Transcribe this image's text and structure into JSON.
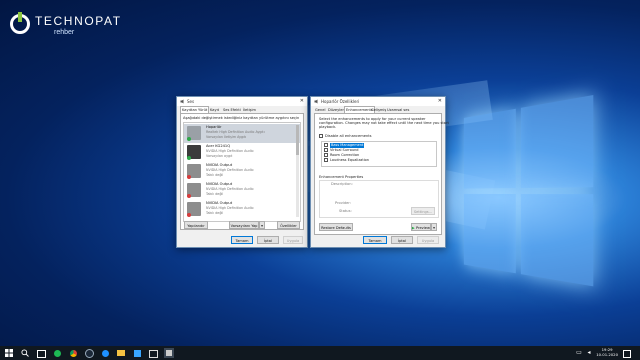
{
  "brand": {
    "name": "TECHNOPAT",
    "sub": "rehber"
  },
  "sound_window": {
    "title": "Ses",
    "tabs": [
      "Kayıttan Yürüt",
      "Kayıt",
      "Ses Efekti",
      "İletişim"
    ],
    "instruction": "Aşağıdaki değiştirmek istediğiniz kayıttan yürütme aygıtını seçin",
    "devices": [
      {
        "name": "Hoparlör",
        "desc": "Realtek High Definition Audio Aygıtı",
        "status": "Varsayılan İletişim Aygıtı",
        "badge": "#2ea84a"
      },
      {
        "name": "Acer KG241Q",
        "desc": "NVIDIA High Definition Audio",
        "status": "Varsayılan aygıt",
        "badge": "#2ea84a"
      },
      {
        "name": "NVIDIA Output",
        "desc": "NVIDIA High Definition Audio",
        "status": "Takılı değil",
        "badge": "#d83b3b"
      },
      {
        "name": "NVIDIA Output",
        "desc": "NVIDIA High Definition Audio",
        "status": "Takılı değil",
        "badge": "#d83b3b"
      },
      {
        "name": "NVIDIA Output",
        "desc": "NVIDIA High Definition Audio",
        "status": "Takılı değil",
        "badge": "#d83b3b"
      }
    ],
    "buttons": {
      "configure": "Yapılandır",
      "set_default": "Varsayılanı Yap",
      "properties": "Özellikler",
      "ok": "Tamam",
      "cancel": "İptal",
      "apply": "Uygula"
    }
  },
  "props_window": {
    "title": "Hoparlör Özellikleri",
    "tabs": [
      "Genel",
      "Düzeyler",
      "Enhancements",
      "Gelişmiş",
      "Uzamsal ses"
    ],
    "description": [
      "Select the enhancements to apply for your current speaker",
      "configuration. Changes may not take effect until the next time you start",
      "playback."
    ],
    "disable_all": "Disable all enhancements",
    "enhancements": [
      {
        "label": "Bass Management",
        "checked": false,
        "highlight": true
      },
      {
        "label": "Virtual Surround",
        "checked": false,
        "highlight": false
      },
      {
        "label": "Room Correction",
        "checked": false,
        "highlight": false
      },
      {
        "label": "Loudness Equalization",
        "checked": false,
        "highlight": false
      }
    ],
    "properties_heading": "Enhancement Properties",
    "description_label": "Description:",
    "provider_label": "Provider:",
    "status_label": "Status:",
    "settings_button": "Settings...",
    "restore_defaults": "Restore Defaults",
    "preview": "Preview",
    "buttons": {
      "ok": "Tamam",
      "cancel": "İptal",
      "apply": "Uygula"
    }
  },
  "taskbar": {
    "time": "19:29",
    "date": "10.01.2020",
    "search_icon": "search-icon",
    "start_icon": "windows-start-icon"
  }
}
